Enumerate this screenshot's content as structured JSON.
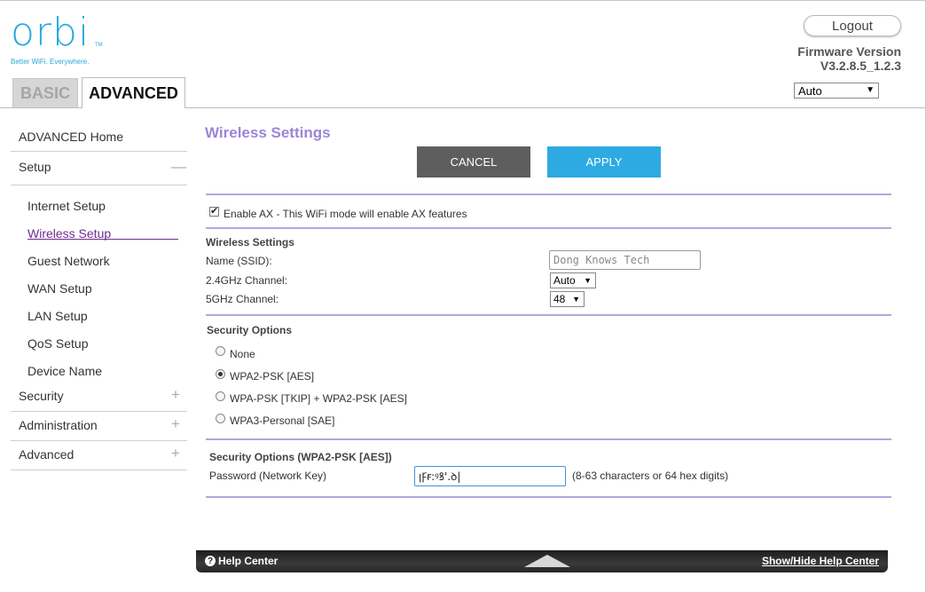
{
  "brand": {
    "logo_text": "orbi",
    "tm": "TM",
    "tagline": "Better WiFi. Everywhere."
  },
  "tabs": {
    "basic": "BASIC",
    "advanced": "ADVANCED"
  },
  "header": {
    "logout": "Logout",
    "firmware_label": "Firmware Version",
    "firmware_value": "V3.2.8.5_1.2.3",
    "language_value": "Auto"
  },
  "sidebar": {
    "home": "ADVANCED Home",
    "setup": {
      "label": "Setup",
      "sign": "—"
    },
    "setup_items": [
      "Internet Setup",
      "Wireless Setup",
      "Guest Network",
      "WAN Setup",
      "LAN Setup",
      "QoS Setup",
      "Device Name"
    ],
    "security": {
      "label": "Security",
      "sign": "+"
    },
    "administration": {
      "label": "Administration",
      "sign": "+"
    },
    "advanced": {
      "label": "Advanced",
      "sign": "+"
    }
  },
  "main": {
    "title": "Wireless Settings",
    "cancel": "CANCEL",
    "apply": "APPLY",
    "enable_ax": {
      "checked": true,
      "label": "Enable AX - This WiFi mode will enable AX features"
    },
    "wireless": {
      "heading": "Wireless Settings",
      "ssid_label": "Name (SSID):",
      "ssid_value": "Dong Knows Tech",
      "ch24_label": "2.4GHz Channel:",
      "ch24_value": "Auto",
      "ch5_label": "5GHz Channel:",
      "ch5_value": "48"
    },
    "security": {
      "heading": "Security Options",
      "options": [
        {
          "label": "None",
          "selected": false
        },
        {
          "label": "WPA2-PSK [AES]",
          "selected": true
        },
        {
          "label": "WPA-PSK [TKIP] + WPA2-PSK [AES]",
          "selected": false
        },
        {
          "label": "WPA3-Personal [SAE]",
          "selected": false
        }
      ]
    },
    "wpa2": {
      "heading": "Security Options (WPA2-PSK [AES])",
      "password_label": "Password (Network Key)",
      "password_value": "ꞁꝻꞧ꞉ꝰꝸ'.ꝺ|",
      "hint": "(8-63 characters or 64 hex digits)"
    }
  },
  "help": {
    "left": "Help Center",
    "right": "Show/Hide Help Center",
    "icon": "?"
  }
}
